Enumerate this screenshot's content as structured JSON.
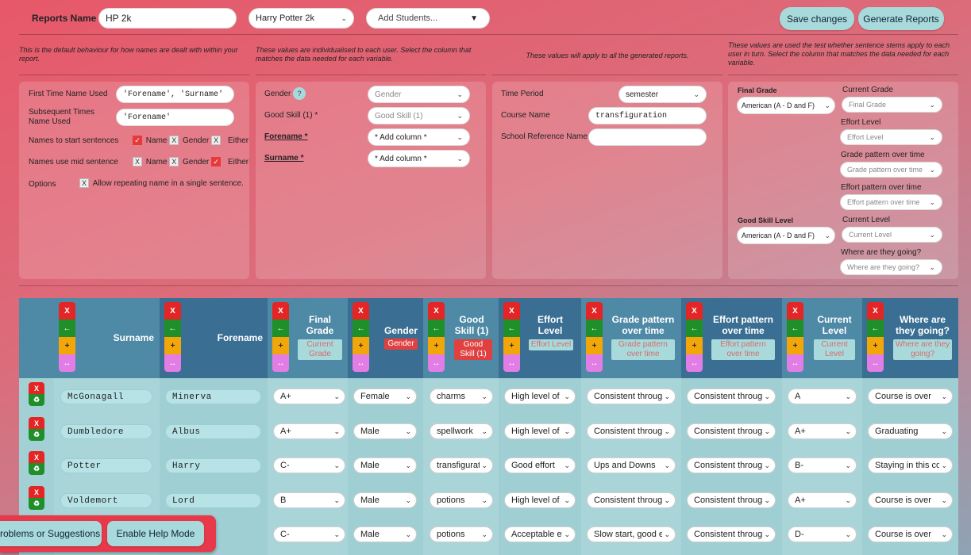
{
  "top": {
    "reports_label": "Reports Name",
    "reports_value": "HP 2k",
    "template_select": "Harry Potter 2k",
    "add_students": "Add Students...",
    "save": "Save changes",
    "generate": "Generate Reports"
  },
  "notes": {
    "n1": "This is the default behaviour for how names are dealt with within your report.",
    "n2": "These values are individualised to each user. Select the column that matches the data needed for each variable.",
    "n3": "These values will apply to all the generated reports.",
    "n4": "These values are used the test whether sentence stems apply to each user in turn. Select the column that matches the data needed for each variable."
  },
  "names_panel": {
    "first_time_label": "First Time Name Used",
    "first_time_value": "'Forename', 'Surname'",
    "subsequent_label": "Subsequent Times Name Used",
    "subsequent_value": "'Forename'",
    "start_label": "Names to start sentences",
    "mid_label": "Names use mid sentence",
    "options_label": "Options",
    "opt_name": "Name",
    "opt_gender": "Gender",
    "opt_either": "Either",
    "allow_repeat": "Allow repeating name in a single sentence.",
    "check_on": "✓",
    "check_off": "X"
  },
  "var_panel": {
    "gender_label": "Gender",
    "help_icon": "?",
    "gender_value": "Gender",
    "good_skill_label": "Good Skill (1) *",
    "good_skill_value": "Good Skill (1)",
    "forename_label": "Forename *",
    "forename_value": "* Add column *",
    "surname_label": "Surname *",
    "surname_value": "* Add column *"
  },
  "global_panel": {
    "time_label": "Time Period",
    "time_value": "semester",
    "course_label": "Course Name",
    "course_value": "transfiguration",
    "school_label": "School Reference Name",
    "school_value": ""
  },
  "stem_panel": {
    "final_grade_label": "Final Grade",
    "final_grade_scale": "American (A - D and F)",
    "current_grade_label": "Current Grade",
    "current_grade_value": "Final Grade",
    "effort_label": "Effort Level",
    "effort_value": "Effort Level",
    "grade_pattern_label": "Grade pattern over time",
    "grade_pattern_value": "Grade pattern over time",
    "effort_pattern_label": "Effort pattern over time",
    "effort_pattern_value": "Effort pattern over time",
    "good_skill_level_label": "Good Skill Level",
    "good_skill_scale": "American (A - D and F)",
    "current_level_label": "Current Level",
    "current_level_value": "Current Level",
    "going_label": "Where are they going?",
    "going_value": "Where are they going?"
  },
  "table": {
    "ctrl": {
      "x": "X",
      "left": "←",
      "plus": "+",
      "resize": "↔",
      "recycle": "♻"
    },
    "headers": {
      "surname": "Surname",
      "forename": "Forename",
      "final_grade": "Final Grade",
      "final_grade_btn": "Current Grade",
      "gender": "Gender",
      "gender_btn": "Gender",
      "good_skill": "Good Skill (1)",
      "good_skill_btn": "Good Skill (1)",
      "effort": "Effort Level",
      "effort_btn": "Effort Level",
      "grade_pattern": "Grade pattern over time",
      "grade_pattern_btn": "Grade pattern over time",
      "effort_pattern": "Effort pattern over time",
      "effort_pattern_btn": "Effort pattern over time",
      "current_level": "Current Level",
      "current_level_btn": "Current Level",
      "going": "Where are they going?",
      "going_btn": "Where are they going?"
    },
    "rows": [
      {
        "surname": "McGonagall",
        "forename": "Minerva",
        "grade": "A+",
        "gender": "Female",
        "skill": "charms",
        "effort": "High level of e",
        "gpat": "Consistent through",
        "epat": "Consistent through",
        "level": "A",
        "going": "Course is over"
      },
      {
        "surname": "Dumbledore",
        "forename": "Albus",
        "grade": "A+",
        "gender": "Male",
        "skill": "spellwork",
        "effort": "High level of e",
        "gpat": "Consistent through",
        "epat": "Consistent through",
        "level": "A+",
        "going": "Graduating"
      },
      {
        "surname": "Potter",
        "forename": "Harry",
        "grade": "C-",
        "gender": "Male",
        "skill": "transfigurati",
        "effort": "Good effort",
        "gpat": "Ups and Downs",
        "epat": "Consistent through",
        "level": "B-",
        "going": "Staying in this co"
      },
      {
        "surname": "Voldemort",
        "forename": "Lord",
        "grade": "B",
        "gender": "Male",
        "skill": "potions",
        "effort": "High level of e",
        "gpat": "Consistent through",
        "epat": "Consistent through",
        "level": "A+",
        "going": "Course is over"
      },
      {
        "surname": "",
        "forename": "",
        "grade": "C-",
        "gender": "Male",
        "skill": "potions",
        "effort": "Acceptable eff",
        "gpat": "Slow start, good er",
        "epat": "Consistent through",
        "level": "D-",
        "going": "Course is over"
      }
    ]
  },
  "help": {
    "problems": "roblems or Suggestions",
    "enable_help": "Enable Help Mode"
  },
  "chevron": "⌄",
  "dropdown_arrow": "▼"
}
